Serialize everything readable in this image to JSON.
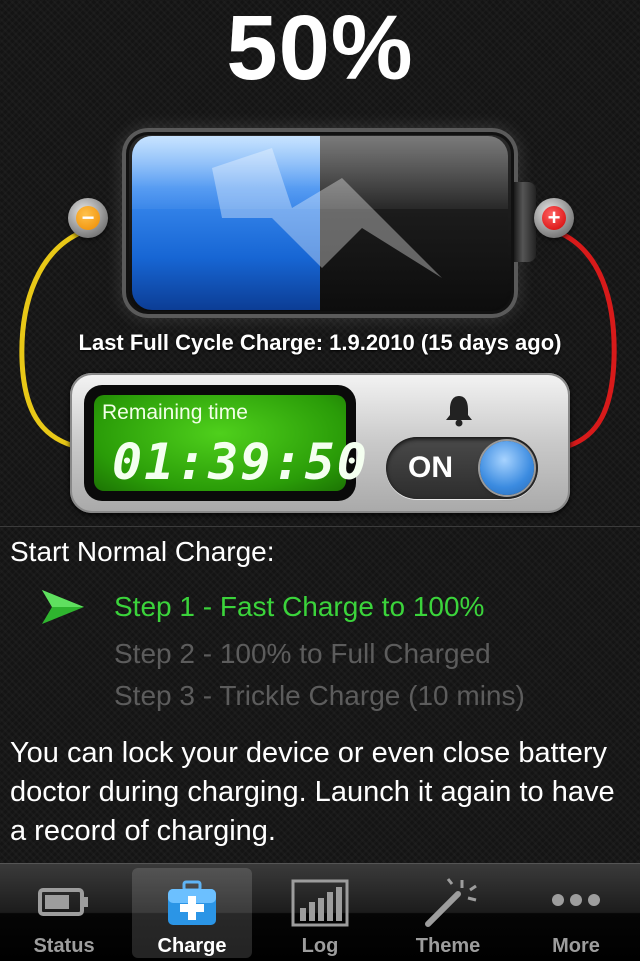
{
  "battery": {
    "percent_label": "50%",
    "level": 0.5,
    "last_full_cycle": "Last Full Cycle Charge: 1.9.2010 (15 days ago)"
  },
  "panel": {
    "remaining_label": "Remaining time",
    "remaining_time": "01:39:50",
    "alarm_toggle_label": "ON",
    "alarm_on": true
  },
  "charge": {
    "heading": "Start Normal Charge:",
    "steps": [
      {
        "label": "Step 1 - Fast Charge to 100%",
        "active": true
      },
      {
        "label": "Step 2 - 100% to Full Charged",
        "active": false
      },
      {
        "label": "Step 3 - Trickle Charge (10 mins)",
        "active": false
      }
    ],
    "info": "You can lock your device or even close battery doctor during charging. Launch it again to have a record of charging."
  },
  "tabs": [
    {
      "label": "Status",
      "icon": "battery-icon",
      "selected": false
    },
    {
      "label": "Charge",
      "icon": "first-aid-kit-icon",
      "selected": true
    },
    {
      "label": "Log",
      "icon": "bar-chart-icon",
      "selected": false
    },
    {
      "label": "Theme",
      "icon": "magic-wand-icon",
      "selected": false
    },
    {
      "label": "More",
      "icon": "more-dots-icon",
      "selected": false
    }
  ],
  "colors": {
    "accent_green": "#3bd43b",
    "battery_blue": "#1766d4",
    "wire_yellow": "#f2d21c",
    "wire_red": "#e02020"
  }
}
